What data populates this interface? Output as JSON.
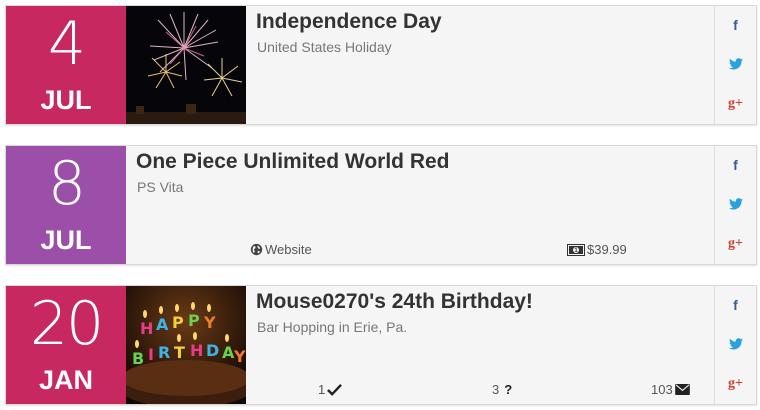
{
  "events": [
    {
      "day": "4",
      "month": "JUL",
      "title": "Independence Day",
      "subtitle": "United States Holiday",
      "color": "#c7285f",
      "image": "fireworks"
    },
    {
      "day": "8",
      "month": "JUL",
      "title": "One Piece Unlimited World Red",
      "subtitle": "PS Vita",
      "color": "#9b4fa8",
      "website_label": "Website",
      "price": "$39.99"
    },
    {
      "day": "20",
      "month": "JAN",
      "title": "Mouse0270's 24th Birthday!",
      "subtitle": "Bar Hopping in Erie, Pa.",
      "color": "#c7285f",
      "image": "birthday-cake",
      "attending": "1",
      "maybe": "3",
      "invited": "103"
    }
  ],
  "social": {
    "facebook": "f",
    "twitter": "twitter-bird-icon",
    "googleplus": "g+"
  }
}
